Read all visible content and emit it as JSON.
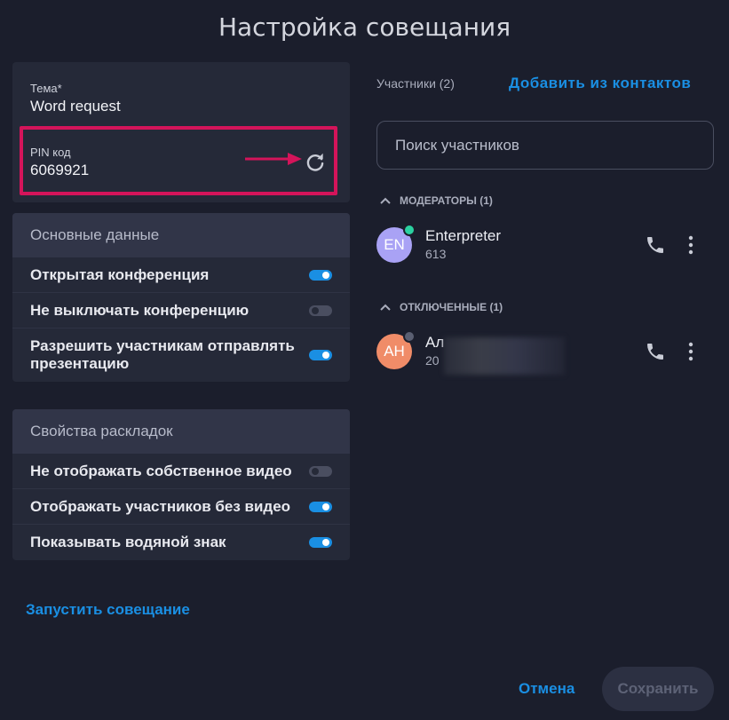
{
  "dialog": {
    "title": "Настройка совещания"
  },
  "meeting": {
    "theme_label": "Тема*",
    "theme_value": "Word request",
    "pin_label": "PIN код",
    "pin_value": "6069921"
  },
  "basic": {
    "header": "Основные данные",
    "items": [
      {
        "label": "Открытая конференция",
        "on": true
      },
      {
        "label": "Не выключать конференцию",
        "on": false
      },
      {
        "label": "Разрешить участникам отправлять презентацию",
        "on": true
      }
    ]
  },
  "layout": {
    "header": "Свойства раскладок",
    "items": [
      {
        "label": "Не отображать собственное видео",
        "on": false
      },
      {
        "label": "Отображать участников без видео",
        "on": true
      },
      {
        "label": "Показывать водяной знак",
        "on": true
      }
    ]
  },
  "launch_label": "Запустить совещание",
  "participants": {
    "label": "Участники (2)",
    "add_contacts": "Добавить из контактов",
    "search_placeholder": "Поиск участников",
    "moderators_header": "МОДЕРАТОРЫ (1)",
    "disconnected_header": "ОТКЛЮЧЕННЫЕ (1)",
    "moderator": {
      "initials": "EN",
      "name": "Enterpreter",
      "number": "613",
      "avatar_color": "#a9a2f5",
      "status_color": "#2bd1a0"
    },
    "disconnected": {
      "initials": "АН",
      "name_visible": "Ал",
      "number_visible": "20",
      "avatar_color": "#f08c68",
      "status_color": "#5a5f72"
    }
  },
  "footer": {
    "cancel_label": "Отмена",
    "save_label": "Сохранить"
  },
  "colors": {
    "accent": "#1a8fe3",
    "highlight": "#d4145a",
    "background": "#1b1e2c",
    "panel": "#252938"
  }
}
